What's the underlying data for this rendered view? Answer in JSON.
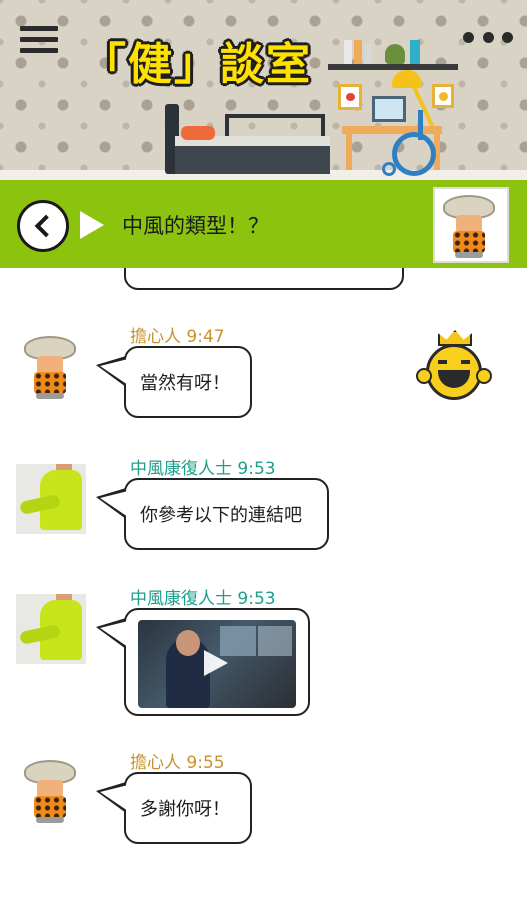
{
  "app": {
    "title": "「健」談室"
  },
  "header": {
    "menu_icon": "hamburger-menu-icon",
    "more_icon": "more-vert-icon"
  },
  "chat_header": {
    "title": "中風的類型！？",
    "back_icon": "chevron-left-icon"
  },
  "messages": [
    {
      "sender": "擔心人",
      "time": "9:47",
      "text": "當然有呀！",
      "sticker": "laughing-crown-emoji"
    },
    {
      "sender": "中風康復人士",
      "time": "9:53",
      "text": "你參考以下的連結吧"
    },
    {
      "sender": "中風康復人士",
      "time": "9:53",
      "type": "video"
    },
    {
      "sender": "擔心人",
      "time": "9:55",
      "text": "多謝你呀！"
    }
  ],
  "colors": {
    "title_bar": "#8bc30f",
    "title_text": "#ffe100",
    "worried_name": "#c8922e",
    "rehab_name": "#1d9f8c"
  }
}
